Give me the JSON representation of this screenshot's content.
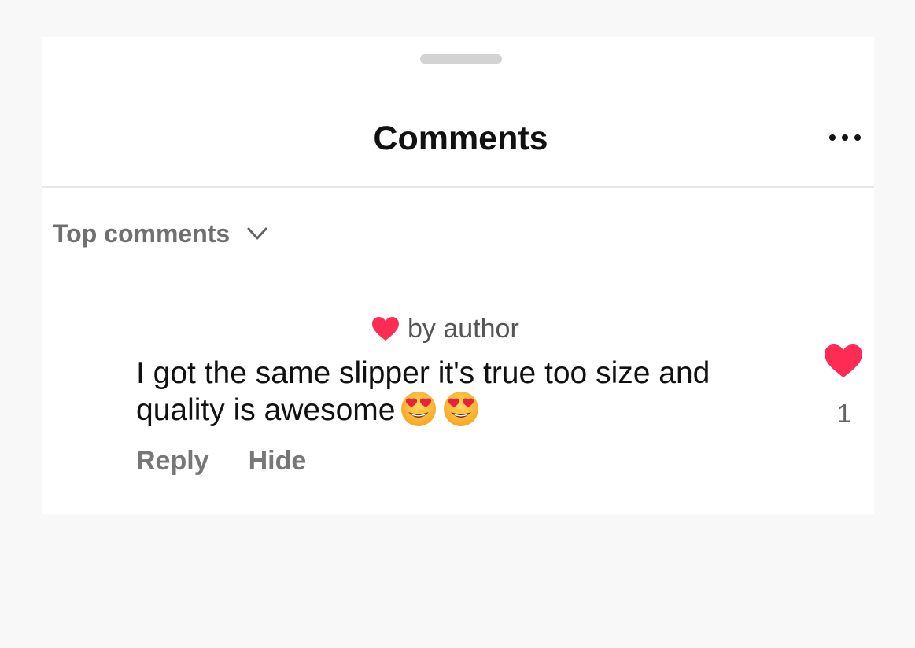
{
  "sheet": {
    "title": "Comments",
    "more_icon": "more-horizontal-icon"
  },
  "sort": {
    "label": "Top comments",
    "icon": "chevron-down-icon"
  },
  "comment": {
    "liked_by_label": "by author",
    "liked_by_icon": "heart-icon",
    "text": "I got the same slipper it's true too size and quality is awesome",
    "emojis": [
      "heart-eyes-emoji",
      "heart-eyes-emoji"
    ],
    "reply_label": "Reply",
    "hide_label": "Hide",
    "like_icon": "heart-filled-icon",
    "like_count": "1"
  },
  "colors": {
    "heart": "#fe2c55",
    "text_primary": "#111111",
    "text_secondary": "#707070",
    "divider": "#e8e8e8"
  }
}
